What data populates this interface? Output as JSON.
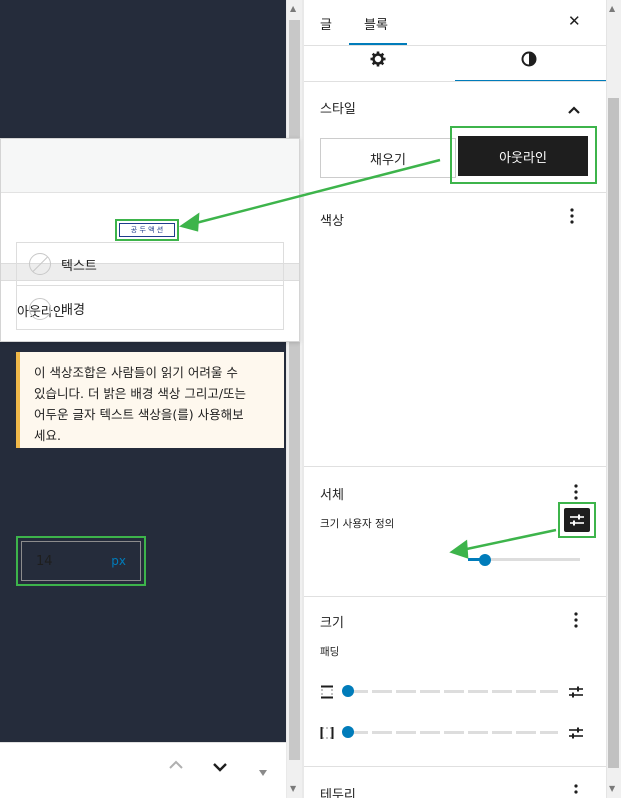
{
  "popup": {
    "mini_button_label": "공 두 액 션",
    "selected_style_label": "아웃라인"
  },
  "bottom_bar": {
    "up_label": "⌃",
    "down_label": "⌄",
    "more_label": "▾"
  },
  "sidebar": {
    "tabs": [
      {
        "label": "글",
        "active": false
      },
      {
        "label": "블록",
        "active": true
      }
    ],
    "close_label": "✕",
    "style_panel": {
      "title": "스타일",
      "options": [
        {
          "label": "채우기",
          "selected": false
        },
        {
          "label": "아웃라인",
          "selected": true
        }
      ]
    },
    "color_panel": {
      "title": "색상",
      "items": [
        {
          "label": "텍스트"
        },
        {
          "label": "배경"
        }
      ],
      "notice_lines": [
        "이 색상조합은 사람들이 읽기 어려울 수",
        "있습니다. 더 밝은 배경 색상 그리고/또는",
        "어두운 글자 텍스트 색상을(를) 사용해보",
        "세요."
      ]
    },
    "typography_panel": {
      "title": "서체",
      "size_label": "크기 사용자 정의",
      "size_value": "14",
      "size_unit": "px",
      "slider_fraction": 0.15
    },
    "dimensions_panel": {
      "title": "크기",
      "padding_label": "패딩",
      "padding_vertical_fraction": 0,
      "padding_horizontal_fraction": 0
    },
    "border_panel": {
      "title": "테두리"
    }
  },
  "colors": {
    "accent": "#007cba",
    "highlight": "#3db44b",
    "notice_border": "#f0b849",
    "canvas_dark": "#252c3b"
  }
}
